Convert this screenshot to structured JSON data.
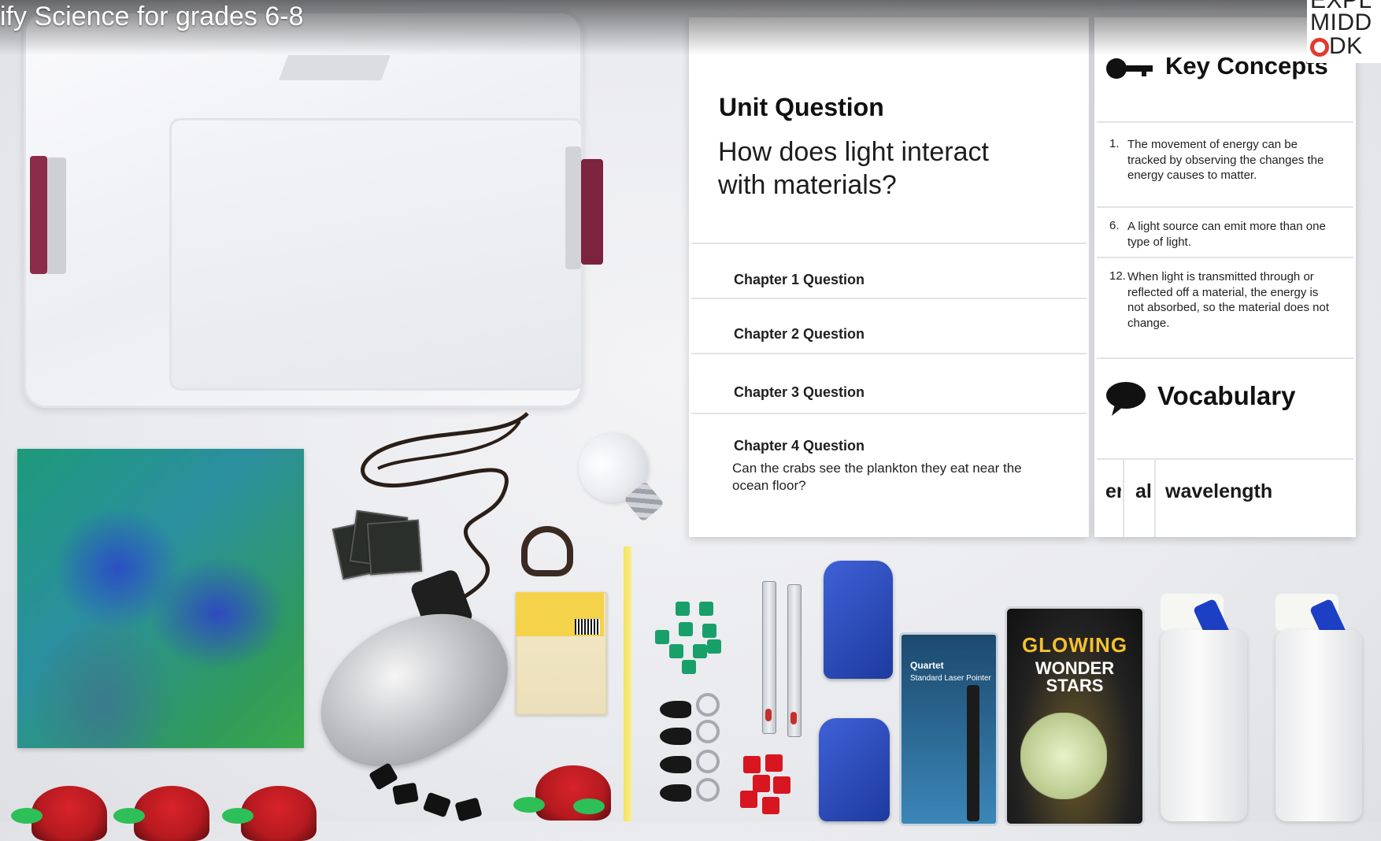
{
  "video": {
    "title": "ify Science for grades 6-8",
    "channel_logo": {
      "lines": [
        "EXPL",
        "MIDD",
        "DK"
      ],
      "accent_color": "#e23b2e"
    }
  },
  "poster": {
    "unit_question_label": "Unit Question",
    "unit_question_text": "How does light interact with materials?",
    "chapter_questions": [
      {
        "label": "Chapter 1 Question",
        "text": ""
      },
      {
        "label": "Chapter 2 Question",
        "text": ""
      },
      {
        "label": "Chapter 3 Question",
        "text": ""
      },
      {
        "label": "Chapter 4 Question",
        "text": "Can the crabs see the plankton they eat near the ocean floor?"
      }
    ]
  },
  "key_concepts": {
    "title": "Key Concepts",
    "icon": "key-icon",
    "items": [
      {
        "number": "1.",
        "text": "The movement of energy can be tracked by observing the changes the energy causes to matter."
      },
      {
        "number": "6.",
        "text": "A light source can emit more than one type of light."
      },
      {
        "number": "12.",
        "text": "When light is transmitted through or reflected off a material, the energy is not absorbed, so the material does not change."
      }
    ]
  },
  "vocabulary": {
    "title": "Vocabulary",
    "icon": "speech-bubble-icon",
    "words": [
      "er",
      "al",
      "wavelength"
    ]
  },
  "kit_items": {
    "stars_package": {
      "title": "GLOWING",
      "subtitle": "WONDER STARS"
    },
    "laser_package": {
      "brand": "Quartet",
      "label": "Standard Laser Pointer"
    }
  }
}
